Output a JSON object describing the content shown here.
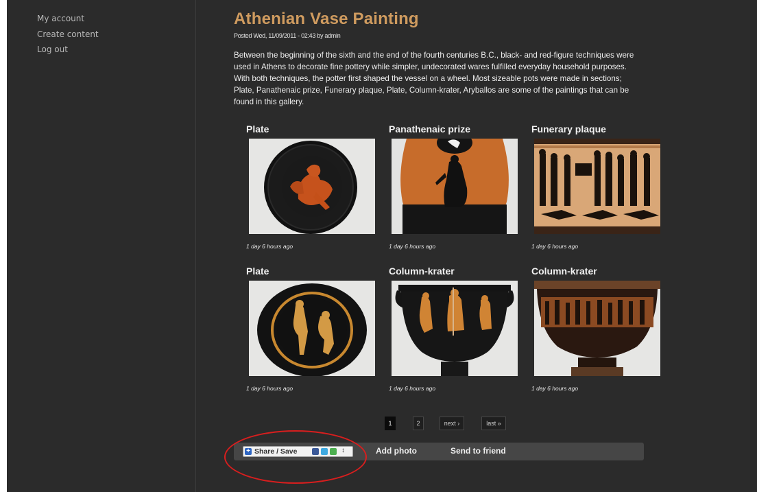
{
  "sidebar": {
    "items": [
      {
        "label": "My account"
      },
      {
        "label": "Create content"
      },
      {
        "label": "Log out"
      }
    ]
  },
  "article": {
    "title": "Athenian Vase Painting",
    "meta": "Posted Wed, 11/09/2011 - 02:43 by admin",
    "body": "Between the beginning of the sixth and the end of the fourth centuries B.C., black- and red-figure techniques were used in Athens to decorate fine pottery while simpler, undecorated wares fulfilled everyday household purposes. With both techniques, the potter first shaped the vessel on a wheel. Most sizeable pots were made in sections; Plate, Panathenaic prize, Funerary plaque, Plate, Column-krater, Aryballos are some of the paintings that can be found in this gallery."
  },
  "gallery": [
    {
      "title": "Plate",
      "time": "1 day 6 hours ago",
      "icon": "red-figure-plate-image"
    },
    {
      "title": "Panathenaic prize",
      "time": "1 day 6 hours ago",
      "icon": "amphora-image"
    },
    {
      "title": "Funerary plaque",
      "time": "1 day 6 hours ago",
      "icon": "funerary-plaque-image"
    },
    {
      "title": "Plate",
      "time": "1 day 6 hours ago",
      "icon": "figures-plate-image"
    },
    {
      "title": "Column-krater",
      "time": "1 day 6 hours ago",
      "icon": "krater-image"
    },
    {
      "title": "Column-krater",
      "time": "1 day 6 hours ago",
      "icon": "krater-frieze-image"
    }
  ],
  "pager": {
    "current": "1",
    "page2": "2",
    "next": "next ›",
    "last": "last »"
  },
  "actions": {
    "share": "Share / Save",
    "share_caret": "↕",
    "add_photo": "Add photo",
    "send_friend": "Send to friend"
  },
  "colors": {
    "background": "#2b2b2b",
    "title": "#cf9b5f",
    "annotation_circle": "#d81e1e"
  }
}
